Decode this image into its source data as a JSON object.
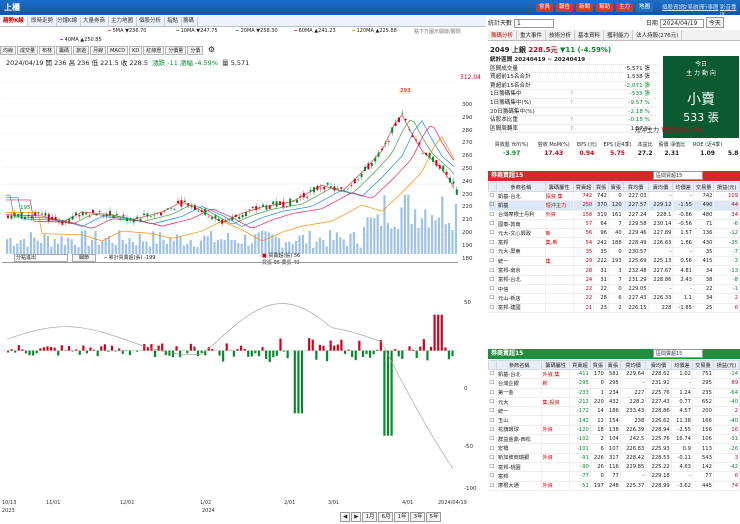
{
  "window": {
    "title": "上櫃"
  },
  "top_buttons": [
    "會員",
    "報告",
    "新聞",
    "幫助",
    "主力",
    "地圖"
  ],
  "top_links": [
    "個股資訊",
    "交易融資",
    "行事曆",
    "影音專區"
  ],
  "chart_tabs": [
    "趨勢K線",
    "即時走勢",
    "分鐘K線",
    "大量券商",
    "主力地圖",
    "個股分析",
    "指點",
    "籌碼"
  ],
  "ma_legend": [
    {
      "label": "40MA ▲250.85",
      "color": "#9c27b0"
    },
    {
      "label": "5MA ▼236.70",
      "color": "#e53935"
    },
    {
      "label": "10MA ▼247.75",
      "color": "#43a047"
    },
    {
      "label": "20MA ▼258.30",
      "color": "#1e88e5"
    },
    {
      "label": "60MA ▲241.23",
      "color": "#e91e63"
    },
    {
      "label": "120MA ▲225.88",
      "color": "#fb8c00"
    }
  ],
  "ma_note": "點下方圖示開啟/關閉",
  "toolbar": [
    "均線",
    "成交量",
    "布林",
    "籌碼",
    "旅遊",
    "月線",
    "MACD",
    "KD",
    "紅綠燈",
    "分價量",
    "分價"
  ],
  "price_info": "2024/04/19 開 236 高 236 低 221.5 收 228.5",
  "change_text": "漲跌 -11  漲幅 -4.59%",
  "volume_text": "量 5,571",
  "price_axis": [
    "300",
    "290",
    "280",
    "270",
    "260",
    "250",
    "240",
    "230",
    "220",
    "210",
    "200",
    "190",
    "180"
  ],
  "current_price": "312.04",
  "peak_label": "293",
  "low_label": "195",
  "lower_controls": {
    "select": "分點進出",
    "button": "細節"
  },
  "lower_legend": {
    "cum": "累計買賣超(張) -199",
    "net": "買賣超(張) 56",
    "buysell": "買張 96 賣張 40"
  },
  "lower_axis": [
    "50",
    "0",
    "-50",
    "-100"
  ],
  "dates": [
    "10/13",
    "2023",
    "11/01",
    "12/01",
    "1/02",
    "2024",
    "2/01",
    "3/01",
    "4/01",
    "2024/04/19"
  ],
  "bottom_controls": [
    "1月",
    "6月",
    "1年",
    "3年",
    "5年"
  ],
  "right": {
    "label_select": "統計天數",
    "days": "1",
    "date_label": "日期",
    "date": "2024/04/19",
    "today_btn": "今天",
    "subtabs": [
      "籌碼分析",
      "重大事件",
      "技術分析",
      "基本資料",
      "獲利能力",
      "法人持股(276元)"
    ],
    "stock_code": "2049 上銀",
    "price": "228.5元",
    "chg": "▼11 (-4.59%)",
    "stats_title": "統計區間 20240419 ~ 20240419",
    "stats": [
      {
        "k": "區間成交量",
        "q": "",
        "v": "5,571 張"
      },
      {
        "k": "買超前15名合計",
        "q": "",
        "v": "1,538 張"
      },
      {
        "k": "賣超前15名合計",
        "q": "",
        "v": "-2,071 張"
      },
      {
        "k": "1日籌碼集中",
        "q": "?",
        "v": "-533 張"
      },
      {
        "k": "1日籌碼集中(%)",
        "q": "?",
        "v": "-9.57 %"
      },
      {
        "k": "20日籌碼集中(%)",
        "q": "",
        "v": "-2.18 %"
      },
      {
        "k": "佔股本比重",
        "q": "?",
        "v": "-0.15 %"
      },
      {
        "k": "區間周轉率",
        "q": "?",
        "v": "1.57 %"
      }
    ],
    "today": "今日",
    "flow": "主 力 動 向",
    "verdict": "小賣",
    "lots": "533 張",
    "short": "短沖主力",
    "short_pct": "買超佔比4.49%",
    "kpi_heads": [
      "買收盤 YoY(%)",
      "營收 MoM(%)",
      "EPS (元)",
      "EPS (近4季)",
      "本益比",
      "股價 淨值比",
      "ROE (近4季)"
    ],
    "kpi_vals": [
      "-3.97",
      "17.43",
      "0.94",
      "5.75",
      "27.2",
      "2.31",
      "1.09",
      "5.8"
    ],
    "buy": {
      "title": "券商買超15",
      "mode": "區間買超15",
      "sub": "券商名稱",
      "tags": "",
      "cols": [
        "參商名稱",
        "籌碼屬性",
        "買賣超",
        "買張",
        "賣張",
        "買均價",
        "賣均價",
        "均價差",
        "交易量",
        "損益(元)"
      ],
      "rows": [
        [
          "凱基-台北",
          "投資,集",
          "742",
          "742",
          "0",
          "227.03",
          "-",
          "-",
          "742",
          "109"
        ],
        [
          "凱基",
          "短沖主力",
          "250",
          "370",
          "120",
          "227.57",
          "229.12",
          "-1.55",
          "490",
          "44"
        ],
        [
          "台灣摩根士丹利",
          "外資",
          "158",
          "319",
          "161",
          "227.24",
          "228.1",
          "-0.86",
          "480",
          "34"
        ],
        [
          "國泰-敦南",
          "",
          "57",
          "64",
          "7",
          "229.58",
          "230.14",
          "-0.56",
          "71",
          "-6"
        ],
        [
          "元大-文心興政",
          "新",
          "56",
          "96",
          "40",
          "229.46",
          "227.89",
          "1.57",
          "136",
          "-12"
        ],
        [
          "富邦",
          "集,新",
          "54",
          "242",
          "188",
          "228.49",
          "226.63",
          "1.86",
          "430",
          "-35"
        ],
        [
          "元大-屏東",
          "",
          "35",
          "35",
          "0",
          "230.57",
          "-",
          "-",
          "35",
          "-7"
        ],
        [
          "統一",
          "集",
          "29",
          "222",
          "193",
          "225.69",
          "225.13",
          "0.56",
          "415",
          "-3"
        ],
        [
          "富邦-南京",
          "",
          "28",
          "31",
          "3",
          "232.48",
          "227.67",
          "4.81",
          "34",
          "-13"
        ],
        [
          "富邦-台北",
          "",
          "24",
          "31",
          "7",
          "231.29",
          "228.86",
          "2.43",
          "38",
          "-8"
        ],
        [
          "中信",
          "",
          "22",
          "22",
          "0",
          "229.05",
          "-",
          "-",
          "22",
          "-1"
        ],
        [
          "元山-新店",
          "",
          "22",
          "28",
          "6",
          "227.43",
          "226.33",
          "1.1",
          "34",
          "2"
        ],
        [
          "富邦-建國",
          "",
          "21",
          "23",
          "2",
          "226.15",
          "228",
          "-1.85",
          "25",
          "6"
        ]
      ]
    },
    "sell": {
      "title": "券商賣超15",
      "mode": "區間賣超15",
      "cols": [
        "參商名稱",
        "籌碼屬性",
        "買賣超",
        "買張",
        "賣張",
        "買均價",
        "賣均價",
        "均價差",
        "交易量",
        "損益(元)"
      ],
      "rows": [
        [
          "凱基-台北",
          "外資,集",
          "-411",
          "170",
          "581",
          "229.64",
          "228.62",
          "1.02",
          "751",
          "-14"
        ],
        [
          "台灣企銀",
          "新",
          "-295",
          "0",
          "295",
          "-",
          "231.91",
          "-",
          "295",
          "89"
        ],
        [
          "第一金",
          "",
          "-233",
          "1",
          "234",
          "227",
          "225.76",
          "1.24",
          "235",
          "-64"
        ],
        [
          "元大",
          "集,投資",
          "-212",
          "220",
          "432",
          "228.2",
          "227.43",
          "0.77",
          "652",
          "-40"
        ],
        [
          "統一",
          "",
          "-172",
          "14",
          "186",
          "233.43",
          "228.86",
          "4.57",
          "200",
          "2"
        ],
        [
          "玉山",
          "",
          "-142",
          "12",
          "154",
          "238",
          "226.62",
          "11.38",
          "166",
          "-40"
        ],
        [
          "花旗環球",
          "外資",
          "-120",
          "18",
          "138",
          "226.39",
          "228.94",
          "-2.55",
          "156",
          "16"
        ],
        [
          "群益金鼎-西松",
          "",
          "-102",
          "2",
          "104",
          "242.5",
          "225.76",
          "16.74",
          "106",
          "-31"
        ],
        [
          "宏橋",
          "",
          "-101",
          "6",
          "107",
          "226.83",
          "225.93",
          "0.9",
          "113",
          "-26"
        ],
        [
          "新加坡商瑞銀",
          "外資",
          "-91",
          "226",
          "317",
          "228.42",
          "228.53",
          "-0.11",
          "543",
          "3"
        ],
        [
          "富邦-桃園",
          "",
          "-90",
          "26",
          "116",
          "229.85",
          "225.22",
          "4.63",
          "142",
          "-42"
        ],
        [
          "富邦",
          "",
          "-77",
          "0",
          "77",
          "-",
          "229.18",
          "-",
          "77",
          "6"
        ],
        [
          "摩根大通",
          "外資",
          "-51",
          "197",
          "248",
          "225.37",
          "228.99",
          "-3.62",
          "445",
          "74"
        ]
      ]
    }
  }
}
